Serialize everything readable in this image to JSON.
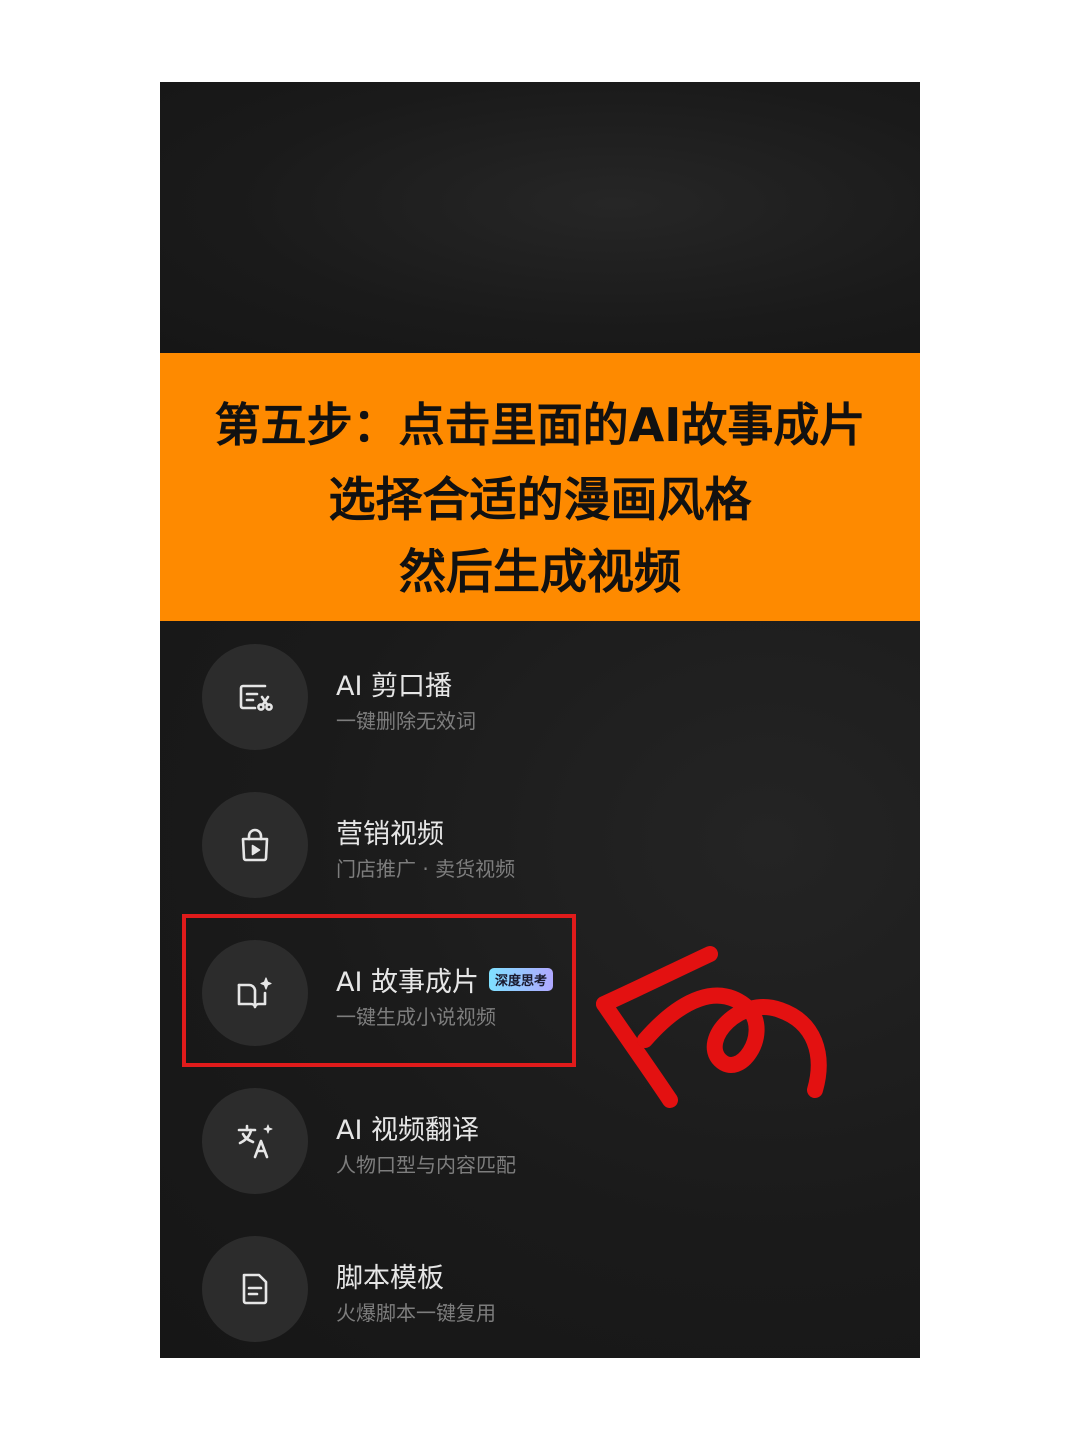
{
  "banner": {
    "line1": "第五步：点击里面的AI故事成片",
    "line2": "选择合适的漫画风格",
    "line3": "然后生成视频"
  },
  "menu": {
    "items": [
      {
        "title": "AI 剪口播",
        "subtitle": "一键删除无效词",
        "icon": "text-cut-icon"
      },
      {
        "title": "营销视频",
        "subtitle": "门店推广 · 卖货视频",
        "icon": "shopping-bag-play-icon"
      },
      {
        "title": "AI 故事成片",
        "badge": "深度思考",
        "subtitle": "一键生成小说视频",
        "icon": "book-sparkle-icon"
      },
      {
        "title": "AI 视频翻译",
        "subtitle": "人物口型与内容匹配",
        "icon": "translate-icon"
      },
      {
        "title": "脚本模板",
        "subtitle": "火爆脚本一键复用",
        "icon": "document-icon"
      }
    ]
  },
  "colors": {
    "banner_bg": "#fe8a00",
    "screen_bg": "#181818",
    "highlight": "#e01b1b"
  }
}
